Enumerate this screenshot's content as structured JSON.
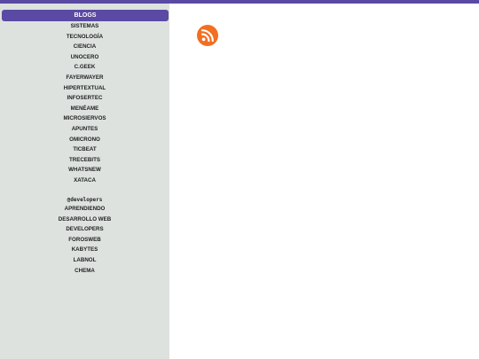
{
  "sidebar": {
    "header": "BLOGS",
    "blogs": [
      {
        "label": "SISTEMAS"
      },
      {
        "label": "TECNOLOGÍA"
      },
      {
        "label": "CIENCIA"
      },
      {
        "label": "UNOCERO"
      },
      {
        "label": "C.GEEK"
      },
      {
        "label": "FAYERWAYER"
      },
      {
        "label": "HIPERTEXTUAL"
      },
      {
        "label": "INFOSERTEC"
      },
      {
        "label": "MENÉAME"
      },
      {
        "label": "MICROSIERVOS"
      },
      {
        "label": "APUNTES"
      },
      {
        "label": "OMICRONO"
      },
      {
        "label": "TICBEAT"
      },
      {
        "label": "TRECEBITS"
      },
      {
        "label": "WHATSNEW"
      },
      {
        "label": "XATACA"
      }
    ],
    "developers_title": "@developers",
    "developers": [
      {
        "label": "APRENDIENDO"
      },
      {
        "label": "DESARROLLO WEB"
      },
      {
        "label": "DEVELOPERS"
      },
      {
        "label": "FOROSWEB"
      },
      {
        "label": "KABYTES"
      },
      {
        "label": "LABNOL"
      },
      {
        "label": "CHEMA"
      }
    ]
  },
  "main": {
    "icon": "rss-icon",
    "icon_color": "#f26f21"
  },
  "colors": {
    "accent": "#5a4aa3",
    "sidebar_bg": "#dde2df"
  }
}
